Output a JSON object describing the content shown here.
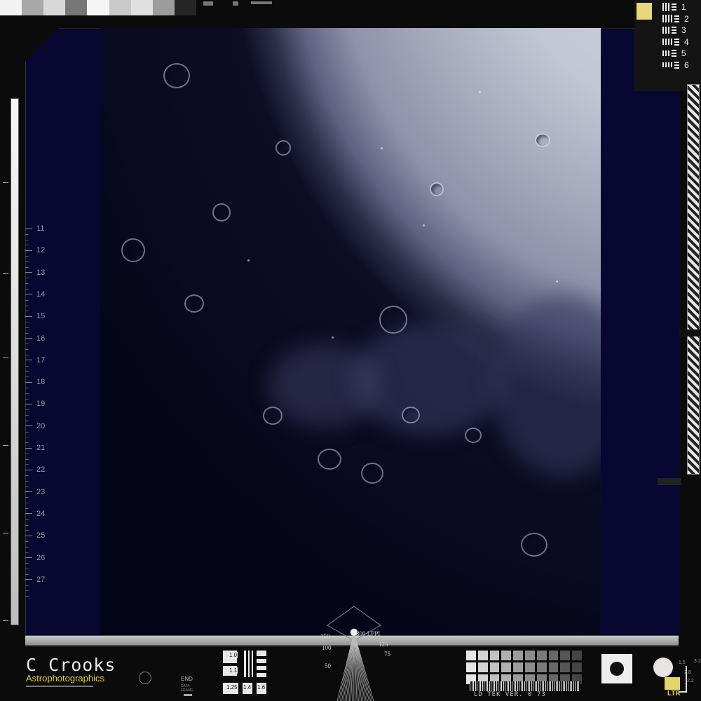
{
  "logo": {
    "title": "C Crooks",
    "subtitle": "Astrophotographics"
  },
  "left_scale": {
    "labels": [
      "11",
      "12",
      "13",
      "14",
      "15",
      "16",
      "17",
      "18",
      "19",
      "20",
      "21",
      "22",
      "23",
      "24",
      "25",
      "26",
      "27"
    ]
  },
  "resolution_target": {
    "labels": [
      "1",
      "2",
      "3",
      "4",
      "5",
      "6"
    ]
  },
  "bottom_panel": {
    "end_label": "END",
    "end_sub": "DATA FRAME",
    "gauge_labels": [
      "1.0",
      "1.1",
      "1.25",
      "1.4",
      "1.6"
    ],
    "fan_labels": {
      "top_left": "150",
      "top_right": "300 LPPI",
      "mid_left": "100",
      "mid_right": "125",
      "lower_right": "75",
      "lower_left": "50"
    },
    "tek_label": "LD TEK VER. 0 73",
    "corner_label": "LTR",
    "corner_nums": [
      "1.5",
      "2.8",
      "2.2",
      "3.2"
    ]
  },
  "colors": {
    "frame_blue": "#070732",
    "logo_yellow": "#e3cf3f",
    "corner_yellow": "#e2d46b"
  }
}
